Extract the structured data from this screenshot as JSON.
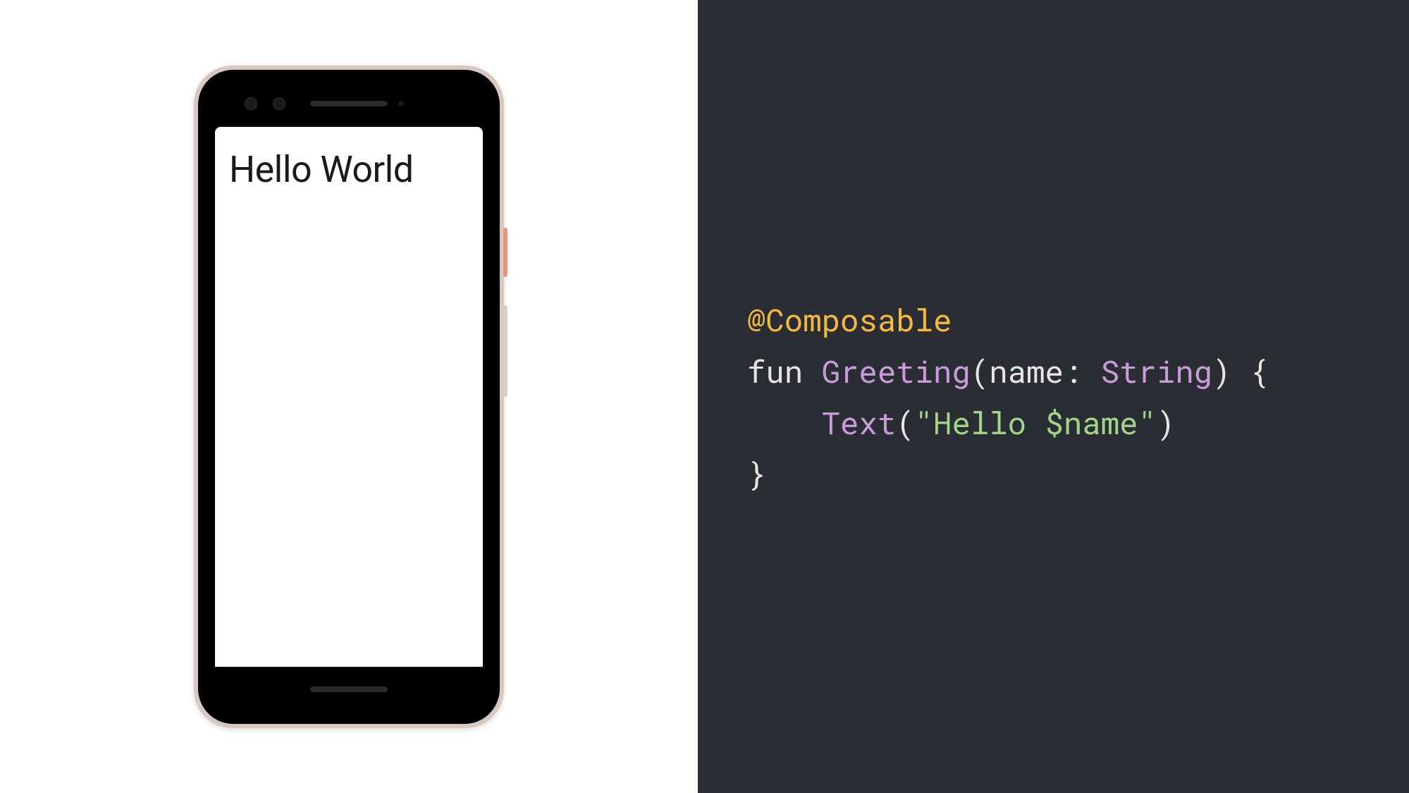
{
  "preview": {
    "screen_text": "Hello World"
  },
  "code": {
    "annotation": "@Composable",
    "keyword_fun": "fun",
    "function_name": "Greeting",
    "paren_open": "(",
    "param_name": "name",
    "colon": ":",
    "param_type": "String",
    "paren_close": ")",
    "brace_open": "{",
    "indent": "    ",
    "call_name": "Text",
    "call_paren_open": "(",
    "string_literal": "\"Hello $name\"",
    "call_paren_close": ")",
    "brace_close": "}"
  }
}
